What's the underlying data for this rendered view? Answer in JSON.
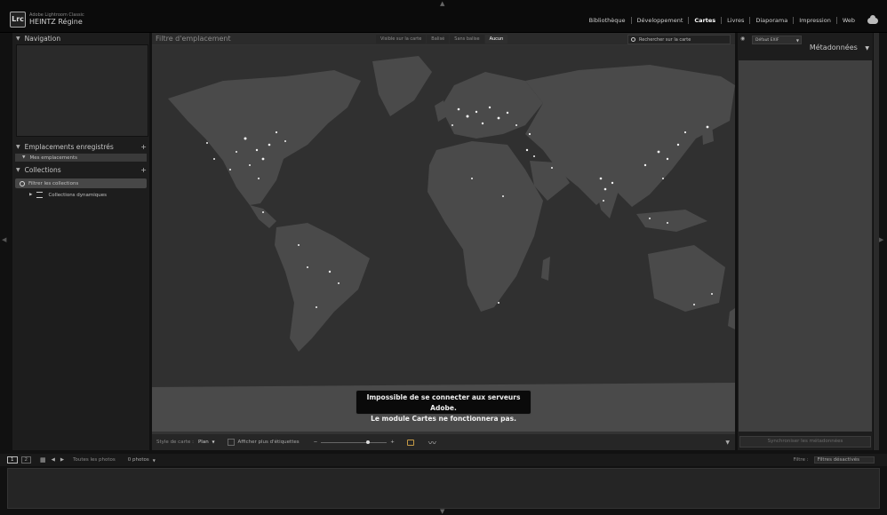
{
  "app": {
    "name": "Adobe Lightroom Classic",
    "logo": "Lrc",
    "user": "HEINTZ Régine"
  },
  "modules": [
    "Bibliothèque",
    "Développement",
    "Cartes",
    "Livres",
    "Diaporama",
    "Impression",
    "Web"
  ],
  "active_module": "Cartes",
  "left_panel": {
    "navigation": "Navigation",
    "saved_locations": "Emplacements enregistrés",
    "my_locations": "Mes emplacements",
    "collections": "Collections",
    "filter_collections": "Filtrer les collections",
    "smart_collections": "Collections dynamiques",
    "plus": "+"
  },
  "center": {
    "filter_label": "Filtre d'emplacement",
    "filter_buttons": [
      "Visible sur la carte",
      "Balisé",
      "Sans balise",
      "Aucun"
    ],
    "active_filter": "Aucun",
    "search_placeholder": "Rechercher sur la carte",
    "error_line1": "Impossible de se connecter aux serveurs Adobe.",
    "error_line2": "Le module Cartes ne fonctionnera pas."
  },
  "toolbar": {
    "map_style_label": "Style de carte :",
    "map_style_value": "Plan",
    "show_labels": "Afficher plus d'étiquettes",
    "zoom_minus": "−",
    "zoom_plus": "+",
    "zoom_level": 0.72
  },
  "right_panel": {
    "preset": "Défaut EXIF",
    "metadata_title": "Métadonnées",
    "sync_button": "Synchroniser les métadonnées"
  },
  "filmstrip": {
    "screen1": "1",
    "screen2": "2",
    "source": "Toutes les photos",
    "count": "0 photos",
    "filter_label": "Filtre :",
    "filter_value": "Filtres désactivés"
  },
  "colors": {
    "background": "#111111",
    "panel": "#1d1d1d",
    "map_land": "#4a4a4a",
    "map_sea": "#303030",
    "city_lights": "#f2f2f2"
  }
}
